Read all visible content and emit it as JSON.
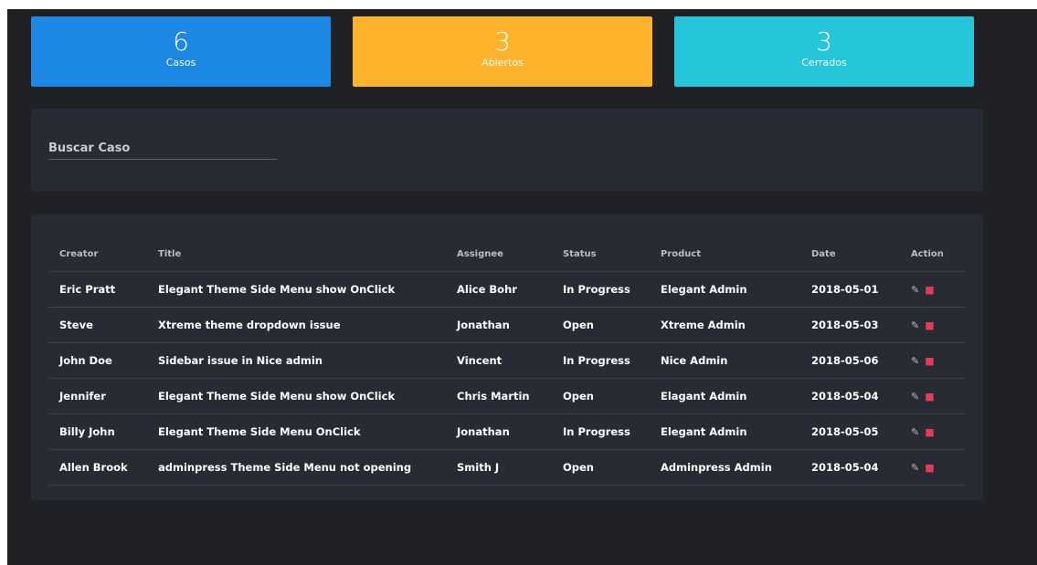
{
  "stats": [
    {
      "value": "6",
      "label": "Casos",
      "color": "#1e88e5"
    },
    {
      "value": "3",
      "label": "Abiertos",
      "color": "#ffb22b"
    },
    {
      "value": "3",
      "label": "Cerrados",
      "color": "#26c6da"
    }
  ],
  "search": {
    "label": "Buscar Caso"
  },
  "table": {
    "headers": {
      "creator": "Creator",
      "title": "Title",
      "assignee": "Assignee",
      "status": "Status",
      "product": "Product",
      "date": "Date",
      "action": "Action"
    },
    "rows": [
      {
        "creator": "Eric Pratt",
        "title": "Elegant Theme Side Menu show OnClick",
        "assignee": "Alice Bohr",
        "status": "In Progress",
        "product": "Elegant Admin",
        "date": "2018-05-01"
      },
      {
        "creator": "Steve",
        "title": "Xtreme theme dropdown issue",
        "assignee": "Jonathan",
        "status": "Open",
        "product": "Xtreme Admin",
        "date": "2018-05-03"
      },
      {
        "creator": "John Doe",
        "title": "Sidebar issue in Nice admin",
        "assignee": "Vincent",
        "status": "In Progress",
        "product": "Nice Admin",
        "date": "2018-05-06"
      },
      {
        "creator": "Jennifer",
        "title": "Elegant Theme Side Menu show OnClick",
        "assignee": "Chris Martin",
        "status": "Open",
        "product": "Elagant Admin",
        "date": "2018-05-04"
      },
      {
        "creator": "Billy John",
        "title": "Elegant Theme Side Menu OnClick",
        "assignee": "Jonathan",
        "status": "In Progress",
        "product": "Elegant Admin",
        "date": "2018-05-05"
      },
      {
        "creator": "Allen Brook",
        "title": "adminpress Theme Side Menu not opening",
        "assignee": "Smith J",
        "status": "Open",
        "product": "Adminpress Admin",
        "date": "2018-05-04"
      }
    ],
    "action_icons": {
      "edit": "pencil-icon",
      "delete": "trash-icon"
    },
    "colors": {
      "delete": "#e63a5b"
    }
  }
}
